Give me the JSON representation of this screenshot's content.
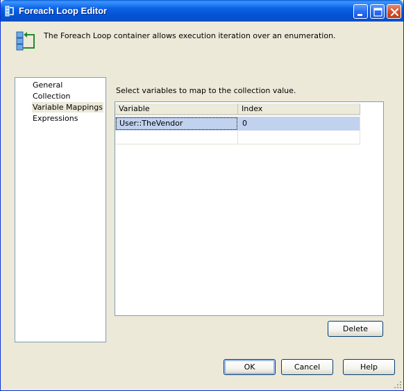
{
  "window": {
    "title": "Foreach Loop Editor",
    "minimize_icon": "minimize-icon",
    "maximize_icon": "maximize-icon",
    "close_icon": "close-icon"
  },
  "header": {
    "description": "The Foreach Loop container allows execution iteration over an enumeration.",
    "icon": "foreach-loop-icon"
  },
  "nav": {
    "items": [
      {
        "label": "General",
        "selected": false
      },
      {
        "label": "Collection",
        "selected": false
      },
      {
        "label": "Variable Mappings",
        "selected": true
      },
      {
        "label": "Expressions",
        "selected": false
      }
    ]
  },
  "main": {
    "instruction": "Select variables to map to the collection value.",
    "grid": {
      "columns": [
        "Variable",
        "Index"
      ],
      "rows": [
        {
          "variable": "User::TheVendor",
          "index": "0",
          "selected": true
        },
        {
          "variable": "",
          "index": "",
          "selected": false
        }
      ]
    },
    "delete_label": "Delete"
  },
  "footer": {
    "ok_label": "OK",
    "cancel_label": "Cancel",
    "help_label": "Help"
  },
  "colors": {
    "titlebar": "#0b61e4",
    "dialog_bg": "#ece9d8",
    "selection": "#c1d2ee",
    "border": "#7f9db9"
  }
}
